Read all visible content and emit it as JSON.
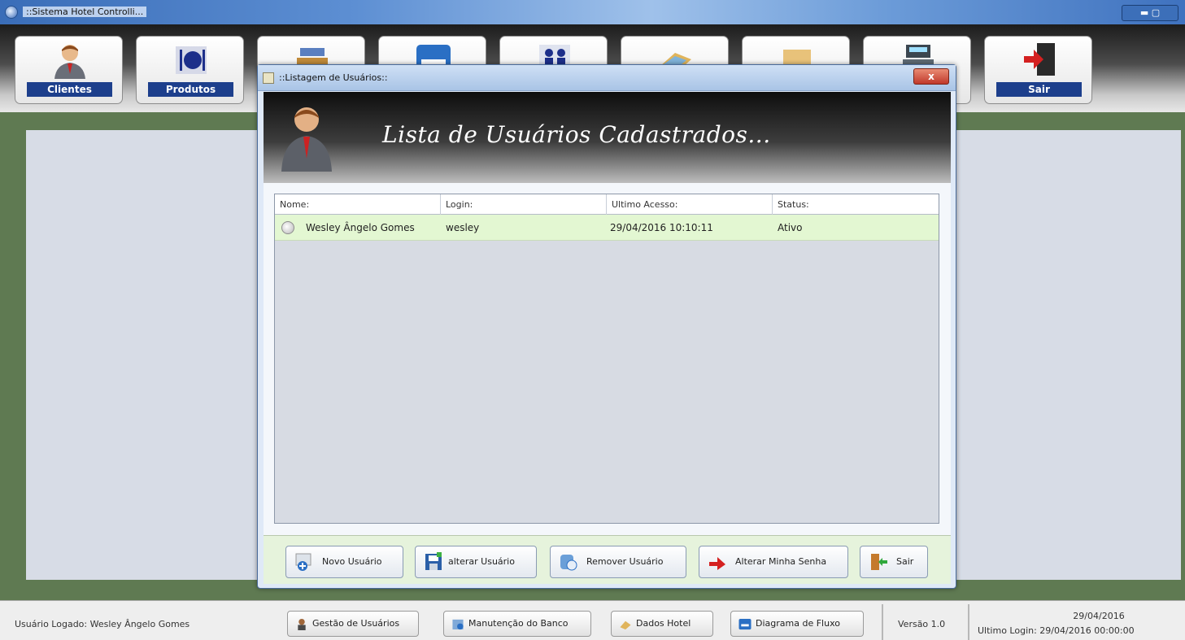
{
  "window": {
    "title": "::Sistema Hotel Controlli...",
    "controls": "▬ ▢"
  },
  "toolbar": {
    "buttons": [
      {
        "label": "Clientes",
        "icon": "person-icon"
      },
      {
        "label": "Produtos",
        "icon": "plate-cutlery-icon"
      },
      {
        "label": "",
        "icon": "desk-icon"
      },
      {
        "label": "",
        "icon": "bed-icon"
      },
      {
        "label": "",
        "icon": "people-icon"
      },
      {
        "label": "",
        "icon": "map-icon"
      },
      {
        "label": "",
        "icon": "building-icon"
      },
      {
        "label": "",
        "icon": "cash-register-icon"
      },
      {
        "label": "Sair",
        "icon": "exit-door-icon"
      }
    ]
  },
  "dialog": {
    "title": "::Listagem de Usuários::",
    "close": "x",
    "header_title": "Lista de Usuários Cadastrados...",
    "columns": [
      "Nome:",
      "Login:",
      "Ultimo Acesso:",
      "Status:"
    ],
    "rows": [
      {
        "nome": "Wesley Ângelo Gomes",
        "login": "wesley",
        "ultimo_acesso": "29/04/2016 10:10:11",
        "status": "Ativo"
      }
    ],
    "buttons": {
      "novo": "Novo Usuário",
      "alterar": "alterar Usuário",
      "remover": "Remover Usuário",
      "alterar_senha": "Alterar Minha Senha",
      "sair": "Sair"
    }
  },
  "status": {
    "user": "Usuário Logado: Wesley Ângelo Gomes",
    "gestao": "Gestão de Usuários",
    "manutencao": "Manutenção do Banco",
    "dados_hotel": "Dados Hotel",
    "diagrama": "Diagrama de Fluxo",
    "versao": "Versão 1.0",
    "date": "29/04/2016",
    "last_login": "Ultimo Login: 29/04/2016 00:00:00"
  }
}
